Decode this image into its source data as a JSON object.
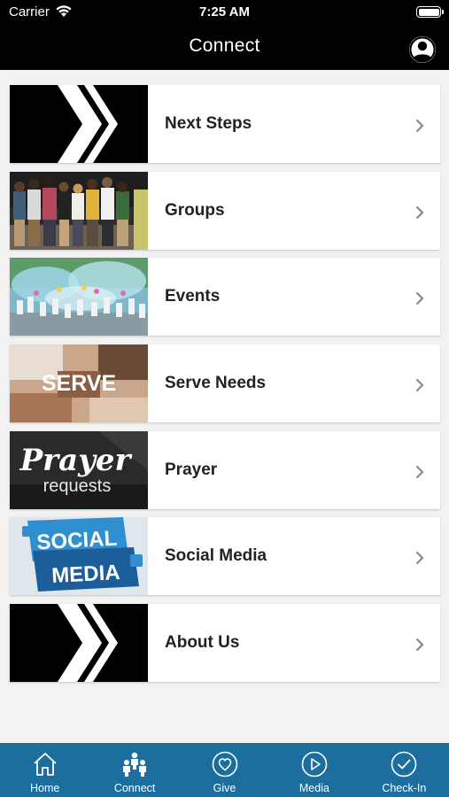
{
  "status": {
    "carrier": "Carrier",
    "time": "7:25 AM"
  },
  "header": {
    "title": "Connect",
    "profile_icon": "user-circle-icon"
  },
  "items": [
    {
      "label": "Next Steps",
      "thumb": "chevron-logo"
    },
    {
      "label": "Groups",
      "thumb": "group-photo"
    },
    {
      "label": "Events",
      "thumb": "event-photo"
    },
    {
      "label": "Serve Needs",
      "thumb": "serve-photo",
      "thumb_text": "SERVE"
    },
    {
      "label": "Prayer",
      "thumb": "prayer-photo",
      "thumb_text": "Prayer",
      "thumb_text2": "requests"
    },
    {
      "label": "Social Media",
      "thumb": "social-media-graphic",
      "thumb_text": "SOCIAL",
      "thumb_text2": "MEDIA"
    },
    {
      "label": "About Us",
      "thumb": "chevron-logo"
    }
  ],
  "tabs": [
    {
      "label": "Home",
      "icon": "house-icon"
    },
    {
      "label": "Connect",
      "icon": "people-icon",
      "active": true
    },
    {
      "label": "Give",
      "icon": "heart-circle-icon"
    },
    {
      "label": "Media",
      "icon": "play-circle-icon"
    },
    {
      "label": "Check-In",
      "icon": "check-circle-icon"
    }
  ],
  "colors": {
    "header": "#000000",
    "tabbar": "#1b6e9e",
    "background": "#f2f2f2"
  }
}
